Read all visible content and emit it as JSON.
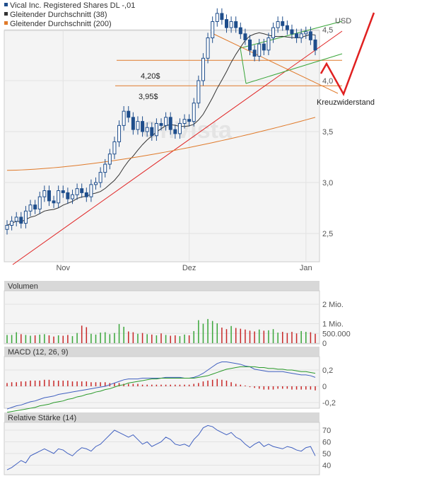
{
  "legend": [
    {
      "label": "Vical Inc. Registered Shares DL -,01",
      "color": "#1f4e8c"
    },
    {
      "label": "Gleitender Durchschnitt (38)",
      "color": "#333333"
    },
    {
      "label": "Gleitender Durchschnitt (200)",
      "color": "#e07a2a"
    }
  ],
  "watermark": "OnVista",
  "colors": {
    "candle": "#1f4e8c",
    "ma38": "#333333",
    "ma200": "#e07a2a",
    "trend_red": "#e02020",
    "channel_green": "#3aa63a",
    "support_orange": "#e07a2a",
    "vol_up": "#3aa63a",
    "vol_down": "#c82828",
    "macd": "#4060c0",
    "signal": "#2a9a2a",
    "rsi": "#4060c0",
    "panel_bg": "#f4f4f4",
    "header_bg": "#d8d8d8"
  },
  "chart_data": [
    {
      "type": "candlestick",
      "title": "",
      "ylabel": "USD",
      "x_ticks": [
        "Nov",
        "Dez",
        "Jan"
      ],
      "y_ticks": [
        2.5,
        3.0,
        3.5,
        4.0,
        4.5
      ],
      "ylim": [
        2.21,
        4.78
      ],
      "annotations": [
        "4,20$",
        "3,95$",
        "Kreuzwiderstand"
      ],
      "support_levels": [
        4.2,
        3.95
      ],
      "close": [
        2.58,
        2.62,
        2.66,
        2.6,
        2.72,
        2.78,
        2.74,
        2.86,
        2.92,
        2.82,
        2.8,
        2.92,
        2.9,
        2.84,
        2.88,
        2.94,
        2.9,
        2.86,
        2.98,
        3.0,
        3.1,
        3.18,
        3.28,
        3.4,
        3.56,
        3.7,
        3.64,
        3.52,
        3.6,
        3.5,
        3.54,
        3.46,
        3.58,
        3.56,
        3.64,
        3.52,
        3.48,
        3.58,
        3.62,
        3.6,
        3.78,
        4.0,
        4.22,
        4.42,
        4.58,
        4.66,
        4.6,
        4.52,
        4.58,
        4.52,
        4.46,
        4.4,
        4.3,
        4.24,
        4.36,
        4.3,
        4.42,
        4.52,
        4.58,
        4.54,
        4.5,
        4.46,
        4.42,
        4.46,
        4.48,
        4.4,
        4.3
      ]
    },
    {
      "type": "bar",
      "title": "Volumen",
      "y_ticks": [
        "0",
        "500.000",
        "1 Mio.",
        "2 Mio."
      ],
      "values": [
        0.42,
        0.42,
        0.56,
        0.46,
        0.42,
        0.38,
        0.4,
        0.44,
        0.46,
        0.4,
        0.34,
        0.4,
        0.38,
        0.42,
        0.36,
        0.52,
        0.9,
        0.82,
        0.48,
        0.44,
        0.54,
        0.56,
        0.46,
        0.52,
        0.98,
        0.84,
        0.6,
        0.56,
        0.48,
        0.52,
        0.46,
        0.44,
        0.4,
        0.5,
        0.42,
        0.38,
        0.4,
        0.36,
        0.44,
        0.4,
        0.62,
        1.18,
        1.0,
        1.24,
        1.14,
        1.02,
        0.8,
        0.72,
        0.88,
        0.78,
        0.74,
        0.7,
        0.64,
        0.6,
        0.7,
        0.64,
        0.66,
        0.72,
        0.54,
        0.58,
        0.52,
        0.58,
        0.5,
        0.62,
        0.58,
        0.56,
        0.48
      ]
    },
    {
      "type": "line",
      "title": "MACD (12, 26, 9)",
      "y_ticks": [
        -0.2,
        0,
        0.2
      ],
      "series": [
        {
          "values": [
            -0.28,
            -0.26,
            -0.24,
            -0.23,
            -0.21,
            -0.19,
            -0.18,
            -0.16,
            -0.14,
            -0.13,
            -0.12,
            -0.1,
            -0.09,
            -0.08,
            -0.07,
            -0.06,
            -0.05,
            -0.04,
            -0.03,
            -0.02,
            -0.01,
            0.0,
            0.02,
            0.04,
            0.06,
            0.08,
            0.09,
            0.09,
            0.09,
            0.1,
            0.1,
            0.1,
            0.1,
            0.1,
            0.11,
            0.11,
            0.11,
            0.11,
            0.1,
            0.1,
            0.11,
            0.13,
            0.16,
            0.2,
            0.24,
            0.28,
            0.3,
            0.3,
            0.29,
            0.28,
            0.27,
            0.25,
            0.24,
            0.21,
            0.2,
            0.19,
            0.18,
            0.18,
            0.18,
            0.18,
            0.17,
            0.16,
            0.15,
            0.14,
            0.14,
            0.13,
            0.11
          ]
        },
        {
          "values": [
            -0.32,
            -0.31,
            -0.3,
            -0.29,
            -0.28,
            -0.27,
            -0.26,
            -0.24,
            -0.23,
            -0.22,
            -0.2,
            -0.19,
            -0.18,
            -0.16,
            -0.15,
            -0.13,
            -0.12,
            -0.1,
            -0.09,
            -0.07,
            -0.06,
            -0.04,
            -0.03,
            -0.01,
            0.01,
            0.02,
            0.04,
            0.05,
            0.06,
            0.07,
            0.08,
            0.09,
            0.09,
            0.1,
            0.1,
            0.1,
            0.1,
            0.1,
            0.1,
            0.1,
            0.1,
            0.11,
            0.12,
            0.13,
            0.15,
            0.17,
            0.19,
            0.21,
            0.22,
            0.23,
            0.24,
            0.24,
            0.24,
            0.24,
            0.23,
            0.23,
            0.22,
            0.22,
            0.21,
            0.21,
            0.2,
            0.2,
            0.19,
            0.18,
            0.18,
            0.17,
            0.16
          ]
        }
      ],
      "histogram": [
        0.04,
        0.05,
        0.05,
        0.06,
        0.06,
        0.07,
        0.07,
        0.07,
        0.08,
        0.08,
        0.07,
        0.07,
        0.07,
        0.07,
        0.06,
        0.06,
        0.06,
        0.06,
        0.05,
        0.05,
        0.05,
        0.05,
        0.04,
        0.04,
        0.04,
        0.03,
        0.03,
        0.03,
        0.03,
        0.02,
        0.02,
        0.02,
        0.02,
        0.02,
        0.02,
        0.02,
        0.02,
        0.02,
        0.02,
        0.02,
        0.03,
        0.04,
        0.06,
        0.07,
        0.08,
        0.09,
        0.08,
        0.07,
        0.05,
        0.03,
        0.02,
        0.01,
        -0.01,
        -0.02,
        -0.03,
        -0.04,
        -0.04,
        -0.04,
        -0.03,
        -0.03,
        -0.03,
        -0.04,
        -0.04,
        -0.04,
        -0.04,
        -0.04,
        -0.05
      ]
    },
    {
      "type": "line",
      "title": "Relative Stärke (14)",
      "y_ticks": [
        40,
        50,
        60,
        70
      ],
      "series": [
        {
          "values": [
            36,
            38,
            41,
            44,
            42,
            48,
            50,
            52,
            54,
            52,
            50,
            54,
            53,
            50,
            48,
            52,
            55,
            54,
            52,
            56,
            58,
            62,
            66,
            70,
            68,
            66,
            64,
            66,
            62,
            58,
            60,
            56,
            58,
            60,
            64,
            62,
            58,
            57,
            58,
            56,
            62,
            66,
            72,
            74,
            73,
            70,
            68,
            66,
            68,
            64,
            62,
            58,
            55,
            58,
            60,
            56,
            58,
            56,
            55,
            54,
            56,
            55,
            53,
            52,
            55,
            56,
            48
          ]
        }
      ]
    }
  ]
}
